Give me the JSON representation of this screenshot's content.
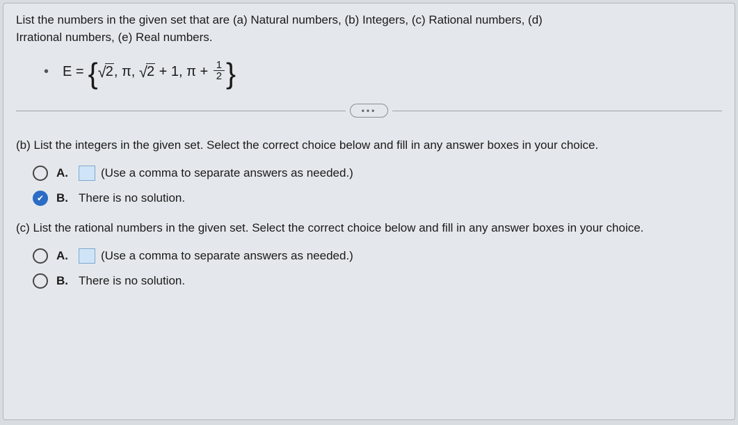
{
  "intro": {
    "line1": "List the numbers in the given set that are (a) Natural numbers, (b) Integers, (c) Rational numbers, (d)",
    "line2": "Irrational numbers, (e) Real numbers."
  },
  "equation": {
    "lhs": "E =",
    "content_text": "{ √2, π, √2 + 1, π + 1/2 }"
  },
  "ellipsis": "•••",
  "partB": {
    "heading": "(b)  List the integers in the given set. Select the correct choice below and fill in any answer boxes in your choice.",
    "optA_letter": "A.",
    "optA_hint": "(Use a comma to separate answers as needed.)",
    "optB_letter": "B.",
    "optB_text": "There is no solution.",
    "selected": "B"
  },
  "partC": {
    "heading": "(c)  List the rational numbers in the given set. Select the correct choice below and fill in any answer boxes in your choice.",
    "optA_letter": "A.",
    "optA_hint": "(Use a comma to separate answers as needed.)",
    "optB_letter": "B.",
    "optB_text": "There is no solution.",
    "selected": ""
  }
}
